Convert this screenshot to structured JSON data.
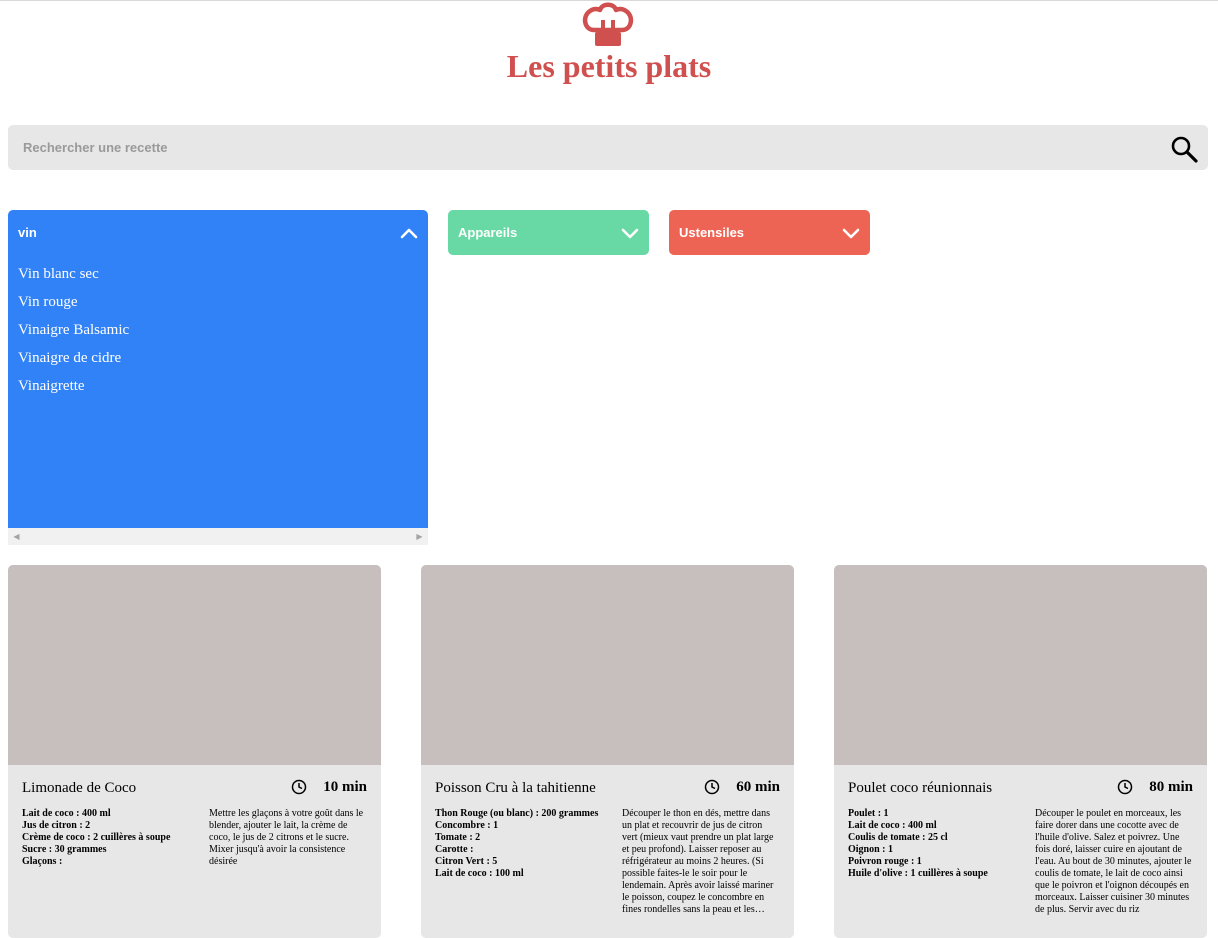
{
  "colors": {
    "brand": "#d04f4f",
    "ingredients": "#3282f7",
    "appareils": "#68d9a4",
    "ustensiles": "#ed6454",
    "card_bg": "#e7e7e7",
    "card_img": "#c7bebe"
  },
  "header": {
    "logo_icon": "chef-hat-icon",
    "title": "Les petits plats"
  },
  "search": {
    "placeholder": "Rechercher une recette",
    "value": "",
    "icon": "search-icon"
  },
  "filters": {
    "ingredients": {
      "input_value": "vin",
      "expanded": true,
      "chevron": "chevron-up-icon",
      "options": [
        "Vin blanc sec",
        "Vin rouge",
        "Vinaigre Balsamic",
        "Vinaigre de cidre",
        "Vinaigrette"
      ]
    },
    "appareils": {
      "label": "Appareils",
      "chevron": "chevron-down-icon"
    },
    "ustensiles": {
      "label": "Ustensiles",
      "chevron": "chevron-down-icon"
    }
  },
  "recipes": [
    {
      "name": "Limonade de Coco",
      "time": "10 min",
      "ingredients": [
        "Lait de coco : 400 ml",
        "Jus de citron : 2",
        "Crème de coco : 2 cuillères à soupe",
        "Sucre : 30 grammes",
        "Glaçons :"
      ],
      "description": "Mettre les glaçons à votre goût dans le blender, ajouter le lait, la crème de coco, le jus de 2 citrons et le sucre. Mixer jusqu'à avoir la consistence désirée"
    },
    {
      "name": "Poisson Cru à la tahitienne",
      "time": "60 min",
      "ingredients": [
        "Thon Rouge (ou blanc) : 200 grammes",
        "Concombre : 1",
        "Tomate : 2",
        "Carotte :",
        "Citron Vert : 5",
        "Lait de coco : 100 ml"
      ],
      "description": "Découper le thon en dés, mettre dans un plat et recouvrir de jus de citron vert (mieux vaut prendre un plat large et peu profond). Laisser reposer au réfrigérateur au moins 2 heures. (Si possible faites-le le soir pour le lendemain. Après avoir laissé mariner le poisson, coupez le concombre en fines rondelles sans la peau et les…"
    },
    {
      "name": "Poulet coco réunionnais",
      "time": "80 min",
      "ingredients": [
        "Poulet : 1",
        "Lait de coco : 400 ml",
        "Coulis de tomate : 25 cl",
        "Oignon : 1",
        "Poivron rouge : 1",
        "Huile d'olive : 1 cuillères à soupe"
      ],
      "description": "Découper le poulet en morceaux, les faire dorer dans une cocotte avec de l'huile d'olive. Salez et poivrez. Une fois doré, laisser cuire en ajoutant de l'eau. Au bout de 30 minutes, ajouter le coulis de tomate, le lait de coco ainsi que le poivron et l'oignon découpés en morceaux. Laisser cuisiner 30 minutes de plus. Servir avec du riz"
    }
  ]
}
